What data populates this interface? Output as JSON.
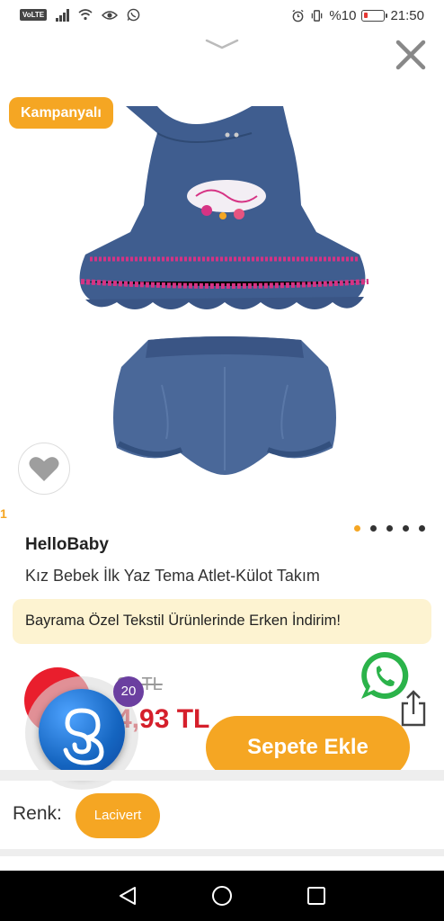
{
  "status_bar": {
    "network_badge": "VoLTE",
    "battery_text": "%10",
    "time": "21:50",
    "icons": [
      "volte-icon",
      "signal-icon",
      "wifi-icon",
      "eye-icon",
      "whatsapp-icon",
      "alarm-icon",
      "vibrate-icon",
      "battery-icon"
    ]
  },
  "header": {
    "collapse_icon": "chevron-down-icon",
    "close_icon": "close-icon"
  },
  "product": {
    "badge": "Kampanyalı",
    "brand": "HelloBaby",
    "name": "Kız Bebek İlk Yaz Tema Atlet-Külot Takım",
    "left_marker": "1",
    "image_count": 5,
    "active_image": 1
  },
  "promo": {
    "text": "Bayrama Özel Tekstil Ürünlerinde Erken İndirim!"
  },
  "price": {
    "old": "90 TL",
    "new": "4,93 TL"
  },
  "assistant": {
    "count": "20"
  },
  "actions": {
    "add_to_cart": "Sepete Ekle",
    "whatsapp_icon": "whatsapp-icon",
    "share_icon": "share-icon",
    "favorite_icon": "heart-icon"
  },
  "color": {
    "label": "Renk:",
    "selected": "Lacivert"
  },
  "nav": {
    "icons": [
      "back-icon",
      "home-icon",
      "recent-apps-icon"
    ]
  },
  "colors": {
    "accent": "#f5a623",
    "price_red": "#d51f2b",
    "promo_bg": "#fdf3d1",
    "denim": "#3e5a8a",
    "trim_pink": "#d63384",
    "assistant_purple": "#6b3fa0"
  }
}
